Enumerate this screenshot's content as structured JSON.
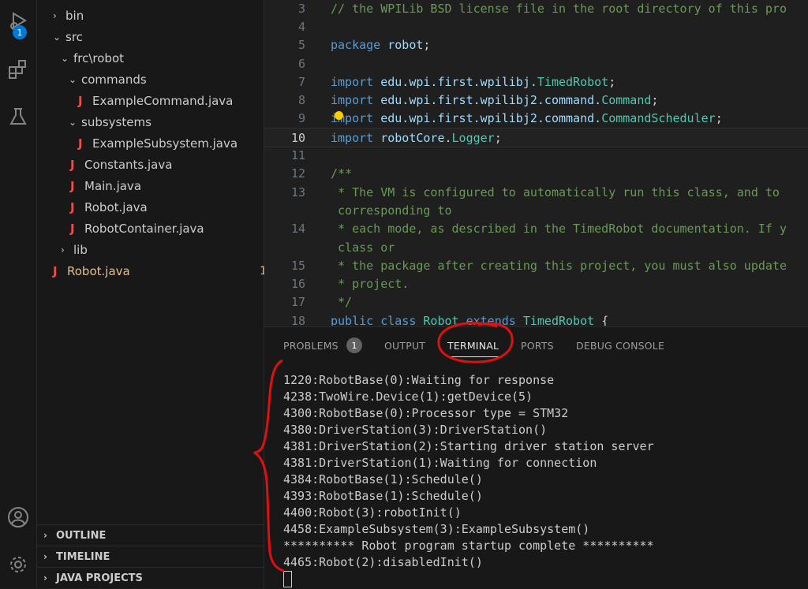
{
  "activity_bar": {
    "run_debug_badge": "1",
    "icons": [
      "run-debug-icon",
      "extensions-icon",
      "testing-icon",
      "account-icon",
      "settings-gear-icon"
    ]
  },
  "explorer": {
    "items": [
      {
        "label": "bin",
        "chevron": "›"
      },
      {
        "label": "src",
        "chevron": "⌄"
      },
      {
        "label": "frc\\robot",
        "chevron": "⌄"
      },
      {
        "label": "commands",
        "chevron": "⌄"
      },
      {
        "label": "ExampleCommand.java",
        "icon": "J"
      },
      {
        "label": "subsystems",
        "chevron": "⌄"
      },
      {
        "label": "ExampleSubsystem.java",
        "icon": "J"
      },
      {
        "label": "Constants.java",
        "icon": "J"
      },
      {
        "label": "Main.java",
        "icon": "J"
      },
      {
        "label": "Robot.java",
        "icon": "J"
      },
      {
        "label": "RobotContainer.java",
        "icon": "J"
      },
      {
        "label": "lib",
        "chevron": "›"
      },
      {
        "label": "Robot.java",
        "icon": "J",
        "count": "1"
      }
    ],
    "sections": [
      "OUTLINE",
      "TIMELINE",
      "JAVA PROJECTS"
    ]
  },
  "editor": {
    "active_line": "10",
    "lines": [
      {
        "n": "3",
        "parts": [
          [
            "cm",
            "// the WPILib BSD license file in the root directory of this pro"
          ]
        ]
      },
      {
        "n": "4",
        "parts": []
      },
      {
        "n": "5",
        "parts": [
          [
            "kw",
            "package "
          ],
          [
            "id",
            "robot"
          ],
          [
            "pl",
            ";"
          ]
        ]
      },
      {
        "n": "6",
        "parts": []
      },
      {
        "n": "7",
        "parts": [
          [
            "kw",
            "import "
          ],
          [
            "id",
            "edu.wpi.first.wpilibj."
          ],
          [
            "cls",
            "TimedRobot"
          ],
          [
            "pl",
            ";"
          ]
        ]
      },
      {
        "n": "8",
        "parts": [
          [
            "kw",
            "import "
          ],
          [
            "id",
            "edu.wpi.first.wpilibj2.command."
          ],
          [
            "cls",
            "Command"
          ],
          [
            "pl",
            ";"
          ]
        ]
      },
      {
        "n": "9",
        "parts": [
          [
            "kw",
            "import "
          ],
          [
            "id",
            "edu.wpi.first.wpilibj2.command."
          ],
          [
            "cls",
            "CommandScheduler"
          ],
          [
            "pl",
            ";"
          ]
        ]
      },
      {
        "n": "10",
        "parts": [
          [
            "kw",
            "import "
          ],
          [
            "id",
            "robotCore."
          ],
          [
            "cls",
            "Logger"
          ],
          [
            "pl",
            ";"
          ]
        ]
      },
      {
        "n": "11",
        "parts": []
      },
      {
        "n": "12",
        "parts": [
          [
            "cm",
            "/**"
          ]
        ]
      },
      {
        "n": "13",
        "parts": [
          [
            "cm",
            " * The VM is configured to automatically run this class, and to"
          ]
        ]
      },
      {
        "n": "",
        "parts": [
          [
            "cm",
            " corresponding to"
          ]
        ]
      },
      {
        "n": "14",
        "parts": [
          [
            "cm",
            " * each mode, as described in the TimedRobot documentation. If y"
          ]
        ]
      },
      {
        "n": "",
        "parts": [
          [
            "cm",
            " class or"
          ]
        ]
      },
      {
        "n": "15",
        "parts": [
          [
            "cm",
            " * the package after creating this project, you must also update"
          ]
        ]
      },
      {
        "n": "16",
        "parts": [
          [
            "cm",
            " * project."
          ]
        ]
      },
      {
        "n": "17",
        "parts": [
          [
            "cm",
            " */"
          ]
        ]
      },
      {
        "n": "18",
        "parts": [
          [
            "kw",
            "public class "
          ],
          [
            "cls",
            "Robot "
          ],
          [
            "kw",
            "extends "
          ],
          [
            "cls",
            "TimedRobot "
          ],
          [
            "pl",
            "{"
          ]
        ]
      }
    ]
  },
  "panel": {
    "tabs": [
      "PROBLEMS",
      "OUTPUT",
      "TERMINAL",
      "PORTS",
      "DEBUG CONSOLE"
    ],
    "problems_count": "1",
    "active_tab": "TERMINAL",
    "terminal_lines": [
      "1220:RobotBase(0):Waiting for response",
      "4238:TwoWire.Device(1):getDevice(5)",
      "4300:RobotBase(0):Processor type = STM32",
      "4380:DriverStation(3):DriverStation()",
      "4381:DriverStation(2):Starting driver station server",
      "4381:DriverStation(1):Waiting for connection",
      "4384:RobotBase(1):Schedule()",
      "4393:RobotBase(1):Schedule()",
      "4400:Robot(3):robotInit()",
      "4458:ExampleSubsystem(3):ExampleSubsystem()",
      "********** Robot program startup complete **********",
      "4465:Robot(2):disabledInit()"
    ]
  },
  "colors": {
    "annotation": "#e01010",
    "accent": "#0078d4",
    "java_icon": "#f14c4c"
  }
}
